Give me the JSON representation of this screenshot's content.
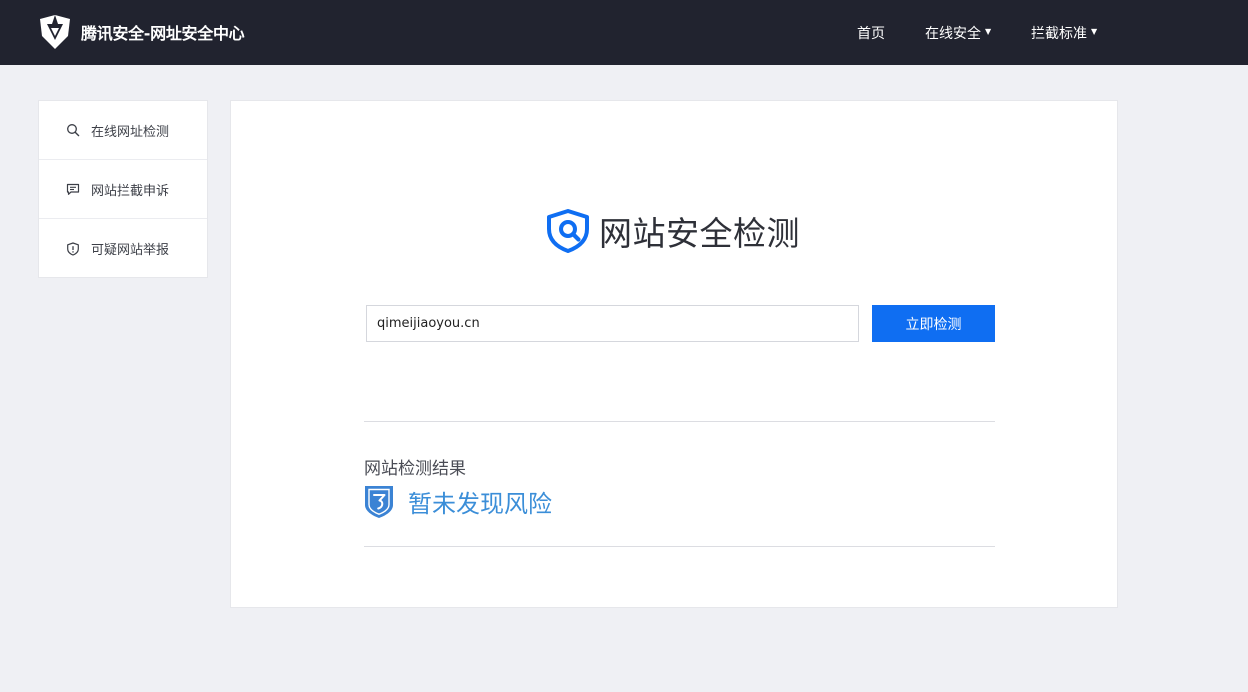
{
  "header": {
    "brand_title": "腾讯安全-网址安全中心",
    "nav": [
      {
        "label": "首页"
      },
      {
        "label": "在线安全"
      },
      {
        "label": "拦截标准"
      }
    ],
    "dropdown_caret": "▼"
  },
  "sidebar": {
    "items": [
      {
        "label": "在线网址检测",
        "icon": "search-icon"
      },
      {
        "label": "网站拦截申诉",
        "icon": "chat-icon"
      },
      {
        "label": "可疑网站举报",
        "icon": "shield-alert-icon"
      }
    ]
  },
  "main": {
    "title": "网站安全检测",
    "url_value": "qimeijiaoyou.cn",
    "check_button_label": "立即检测",
    "result_label": "网站检测结果",
    "result_status": "暂未发现风险"
  },
  "colors": {
    "topbar": "#21232f",
    "accent": "#0f6ef2",
    "safe_status": "#3b8ed8",
    "page_bg": "#eff0f4"
  }
}
